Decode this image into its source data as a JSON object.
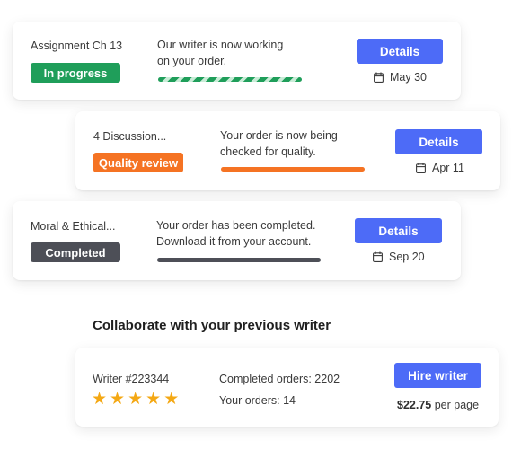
{
  "orders": [
    {
      "title": "Assignment Ch 13",
      "status": "In progress",
      "status_color": "#1f9e5a",
      "message_line1": "Our writer is now working",
      "message_line2": "on your order.",
      "bar_style": "striped",
      "bar_color": "#1f9e5a",
      "button": "Details",
      "date": "May 30",
      "date_icon": "calendar-icon"
    },
    {
      "title": "4 Discussion...",
      "status": "Quality review",
      "status_color": "#f57323",
      "message_line1": "Your order is now being",
      "message_line2": "checked for quality.",
      "bar_style": "solid",
      "bar_color": "#f57323",
      "button": "Details",
      "date": "Apr 11",
      "date_icon": "calendar-icon"
    },
    {
      "title": "Moral & Ethical...",
      "status": "Completed",
      "status_color": "#4d4f57",
      "message_line1": "Your order has been completed.",
      "message_line2": "Download it from your account.",
      "bar_style": "solid",
      "bar_color": "#4d4f57",
      "button": "Details",
      "date": "Sep 20",
      "date_icon": "calendar-icon"
    }
  ],
  "collaborate": {
    "heading": "Collaborate with your previous writer",
    "writer": "Writer #223344",
    "rating_stars": 5,
    "star_icon": "star-icon",
    "star_color": "#f4a814",
    "completed_orders": "Completed orders: 2202",
    "your_orders": "Your orders: 14",
    "button": "Hire writer",
    "price": "$22.75",
    "price_unit": "per page"
  },
  "colors": {
    "accent": "#4d6bf7"
  }
}
